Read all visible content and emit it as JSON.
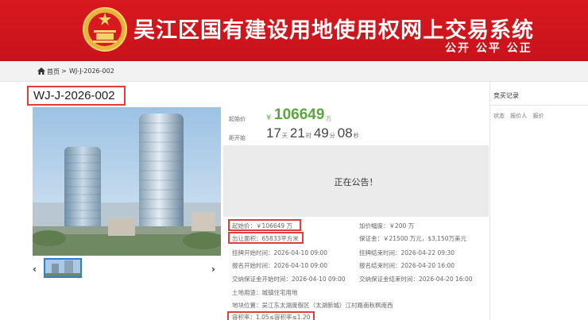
{
  "header": {
    "title": "吴江区国有建设用地使用权网上交易系统",
    "slogan": "公开 公平 公正",
    "emblem_icon": "national-emblem-icon",
    "brand_color": "#c8121a"
  },
  "breadcrumb": {
    "home": "首页",
    "separator": ">",
    "current": "WJ-J-2026-002"
  },
  "lot": {
    "id": "WJ-J-2026-002"
  },
  "price": {
    "label": "起始价",
    "currency": "¥",
    "value": "106649",
    "unit": "万"
  },
  "countdown": {
    "label": "距开始",
    "days": "17",
    "days_unit": "天",
    "hours": "21",
    "hours_unit": "时",
    "minutes": "49",
    "minutes_unit": "分",
    "seconds": "08",
    "seconds_unit": "秒"
  },
  "status": {
    "text": "正在公告！"
  },
  "details": {
    "start_price": "起始价：￥106649 万",
    "bid_increment": "加价幅度：￥200 万",
    "area": "出让面积：65833平方米",
    "deposit": "保证金：￥21500 万元，$3,150万美元",
    "listing_start": "挂牌开始时间：2026-04-10 09:00",
    "listing_end": "挂牌结束时间：2026-04-22 09:30",
    "register_start": "报名开始时间：2026-04-10 09:00",
    "register_end": "报名结束时间：2026-04-20 16:00",
    "deposit_start": "交纳保证金开始时间：2026-04-10 09:00",
    "deposit_end": "交纳保证金结束时间：2026-04-20 16:00",
    "land_use": "土地用途：城镇住宅用地",
    "location": "地块位置：吴江东太湖度假区（太湖新城）江村路南秋枫南西",
    "plot_ratio": "容积率：1.05≤容积率≤1.20"
  },
  "gallery": {
    "prev": "‹",
    "next": "›"
  },
  "bid_records": {
    "title": "竞买记录",
    "columns": [
      "状态",
      "报价人",
      "报价"
    ]
  }
}
